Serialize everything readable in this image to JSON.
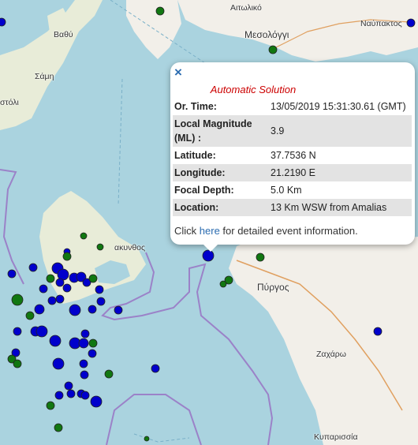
{
  "places": {
    "aitoliko": "Αιτωλικό",
    "vathy": "Βαθύ",
    "mesolongi": "Μεσολόγγι",
    "nafpaktos": "Ναύπακτος",
    "sami": "Σάμη",
    "argostoli": "στόλι",
    "zakynthos": "ακυνθος",
    "pyrgos": "Πύργος",
    "zacharo": "Ζαχάρω",
    "kyparissia": "Κυπαρισσία"
  },
  "popup": {
    "title": "Automatic Solution",
    "rows": [
      {
        "key": "Or. Time:",
        "value": "13/05/2019 15:31:30.61 (GMT)"
      },
      {
        "key": "Local Magnitude (ML) :",
        "value": "3.9"
      },
      {
        "key": "Latitude:",
        "value": "37.7536 N"
      },
      {
        "key": "Longitude:",
        "value": "21.2190 E"
      },
      {
        "key": "Focal Depth:",
        "value": "5.0 Km"
      },
      {
        "key": "Location:",
        "value": "13 Km WSW from Amalias"
      }
    ],
    "footer_pre": "Click ",
    "footer_link": "here",
    "footer_post": " for detailed event information."
  },
  "colors": {
    "water": "#aad3df",
    "land": "#f2efe9",
    "blue_event": "#0000cc",
    "green_event": "#117711",
    "boundary": "#9b82c8"
  }
}
